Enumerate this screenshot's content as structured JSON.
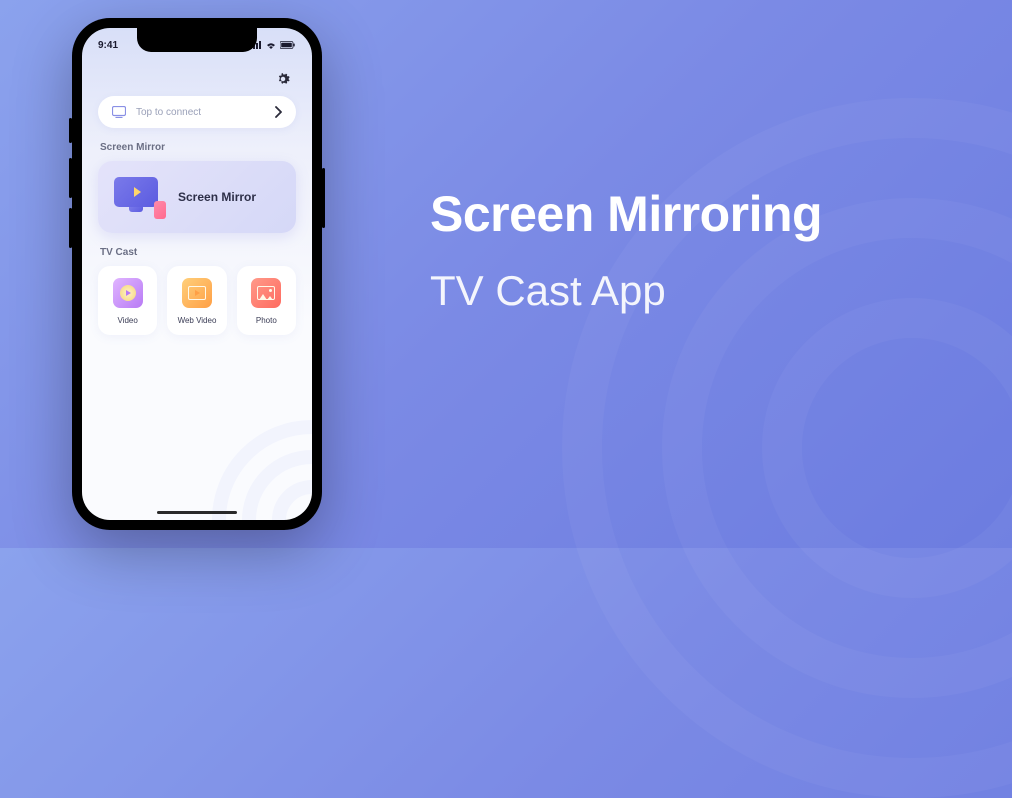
{
  "statusBar": {
    "time": "9:41"
  },
  "connect": {
    "label": "Top to connect"
  },
  "sections": {
    "mirror": {
      "title": "Screen Mirror",
      "cardLabel": "Screen Mirror"
    },
    "cast": {
      "title": "TV Cast",
      "items": [
        {
          "label": "Video"
        },
        {
          "label": "Web Video"
        },
        {
          "label": "Photo"
        }
      ]
    }
  },
  "hero": {
    "title": "Screen Mirroring",
    "subtitle": "TV Cast App"
  }
}
